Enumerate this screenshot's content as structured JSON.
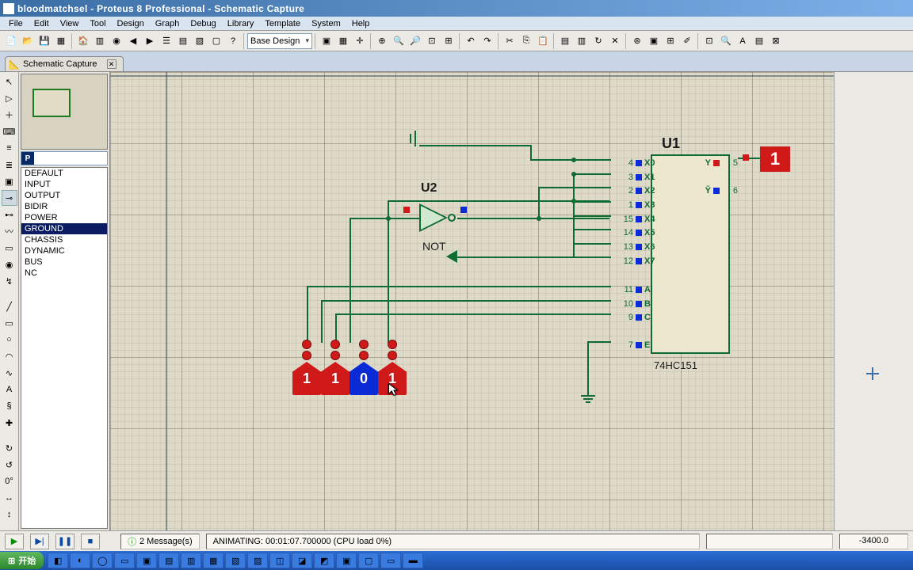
{
  "title": "bloodmatchsel - Proteus 8 Professional - Schematic Capture",
  "menu": [
    "File",
    "Edit",
    "View",
    "Tool",
    "Design",
    "Graph",
    "Debug",
    "Library",
    "Template",
    "System",
    "Help"
  ],
  "designSelector": "Base Design",
  "tab": {
    "label": "Schematic Capture"
  },
  "objectPicker": {
    "button": "P"
  },
  "pinModes": [
    "DEFAULT",
    "INPUT",
    "OUTPUT",
    "BIDIR",
    "POWER",
    "GROUND",
    "CHASSIS",
    "DYNAMIC",
    "BUS",
    "NC"
  ],
  "selectedPinMode": "GROUND",
  "chip": {
    "ref": "U1",
    "part": "74HC151",
    "leftPins": [
      {
        "num": "4",
        "name": "X0"
      },
      {
        "num": "3",
        "name": "X1"
      },
      {
        "num": "2",
        "name": "X2"
      },
      {
        "num": "1",
        "name": "X3"
      },
      {
        "num": "15",
        "name": "X4"
      },
      {
        "num": "14",
        "name": "X5"
      },
      {
        "num": "13",
        "name": "X6"
      },
      {
        "num": "12",
        "name": "X7"
      },
      {
        "num": "11",
        "name": "A"
      },
      {
        "num": "10",
        "name": "B"
      },
      {
        "num": "9",
        "name": "C"
      },
      {
        "num": "7",
        "name": "E"
      }
    ],
    "rightPins": [
      {
        "num": "5",
        "name": "Y"
      },
      {
        "num": "6",
        "name": "Ȳ"
      }
    ]
  },
  "gate": {
    "ref": "U2",
    "type": "NOT"
  },
  "logicStates": [
    "1",
    "1",
    "0",
    "1"
  ],
  "output": "1",
  "sim": {
    "messages": "2 Message(s)",
    "status": "ANIMATING: 00:01:07.700000 (CPU load 0%)",
    "coord": "-3400.0"
  },
  "taskbar": {
    "start": "开始"
  }
}
